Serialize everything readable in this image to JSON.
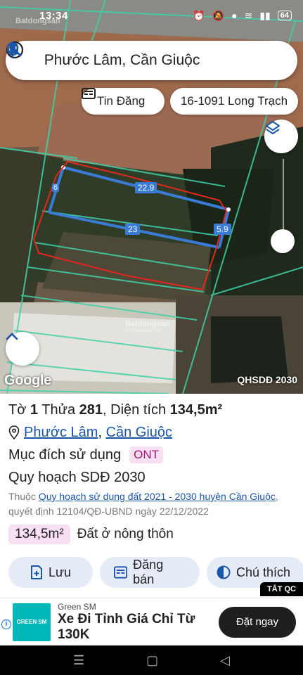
{
  "status_bar": {
    "time": "13:34",
    "battery": "64"
  },
  "watermark": {
    "brand": "Batdongsan",
    "sub": "by PropertyGuru"
  },
  "search": {
    "value": "Phước Lâm, Cần Giuộc"
  },
  "chips": {
    "listing": "Tin Đăng",
    "parcel_code": "16-1091 Long Trạch"
  },
  "map": {
    "dimension_labels": [
      "6",
      "22.9",
      "23",
      "5.9"
    ],
    "google_logo": "Google",
    "layer_name": "QHSDĐ 2030"
  },
  "parcel": {
    "sheet_label": "Tờ",
    "sheet_no": "1",
    "lot_label": "Thửa",
    "lot_no": "281",
    "area_label": ", Diện tích",
    "area_value": "134,5m²",
    "location_ward": "Phước Lâm",
    "location_sep": ", ",
    "location_district": "Cần Giuộc",
    "purpose_label": "Mục đích sử dụng",
    "purpose_code": "ONT",
    "plan_label": "Quy hoạch SDĐ 2030",
    "note_prefix": "Thuộc",
    "note_link": "Quy hoạch sử dụng đất 2021 - 2030 huyện Cần Giuộc",
    "note_suffix": ", quyết định 12104/QĐ-UBND ngày 22/12/2022",
    "area_badge": "134,5m²",
    "area_type": "Đất ở nông thôn"
  },
  "actions": {
    "save": "Lưu",
    "sell": "Đăng bán",
    "legend": "Chú thích"
  },
  "ad": {
    "close_label": "TẮT QC",
    "brand": "Green SM",
    "logo_text": "GREEN SM",
    "headline": "Xe Đi Tỉnh Giá Chỉ Từ 130K",
    "cta": "Đặt ngay"
  },
  "colors": {
    "accent_blue": "#1a56a8",
    "badge_pink": "#f9dff2",
    "parcel_outline": "#e0281f",
    "plan_line": "#3a7bd5",
    "cadastral_line": "#3fd1a8"
  }
}
